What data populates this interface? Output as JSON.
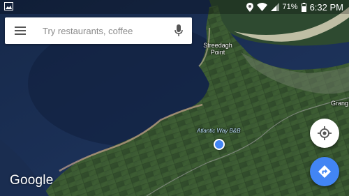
{
  "status_bar": {
    "battery_percent": "71%",
    "time": "6:32 PM",
    "icons": [
      "gallery-icon",
      "location-pin-icon",
      "wifi-icon",
      "signal-icon",
      "battery-icon"
    ]
  },
  "search": {
    "placeholder": "Try restaurants, coffee",
    "value": "",
    "menu_icon": "hamburger-menu-icon",
    "voice_icon": "microphone-icon"
  },
  "map": {
    "labels": {
      "streedagh_line1": "Streedagh",
      "streedagh_line2": "Point",
      "grange": "Grang",
      "atlantic_way": "Atlantic Way B&B"
    },
    "brand": "Google"
  },
  "buttons": {
    "my_location_icon": "crosshair-icon",
    "directions_icon": "directions-arrow-icon"
  },
  "colors": {
    "accent": "#4285f4",
    "sea": "#1b2f52",
    "land": "#3a5a32"
  }
}
